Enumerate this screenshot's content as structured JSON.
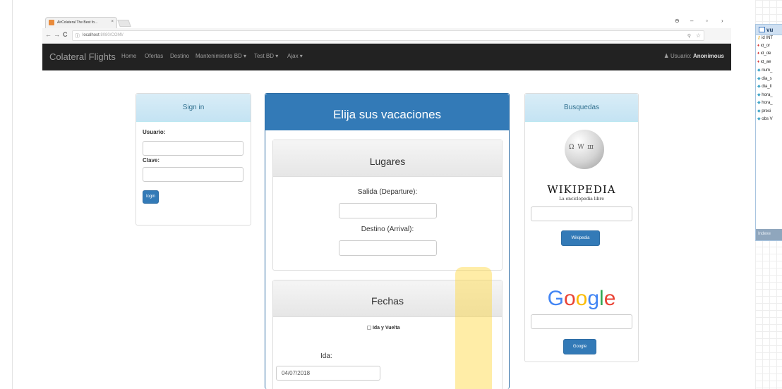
{
  "browser": {
    "tab_title": "AirColateral The Best fo...",
    "tab_close": "×",
    "window_controls": {
      "profile": "⊖",
      "minimize": "–",
      "maximize": "▫",
      "close": "›"
    },
    "url_host": "localhost",
    "url_path": ":8080/COMI/",
    "nav_back": "←",
    "nav_forward": "→",
    "nav_reload": "C",
    "secure_icon": "ⓘ",
    "zoom_icon": "⚲",
    "star_icon": "☆"
  },
  "navbar": {
    "brand": "Colateral Flights",
    "items": [
      "Home",
      "Ofertas",
      "Destino",
      "Mantenimiento BD ▾",
      "Test BD ▾",
      "Ajax ▾"
    ],
    "user_label": "Usuario:",
    "user_name": "Anonimous",
    "user_icon": "person-icon"
  },
  "signin": {
    "title": "Sign in",
    "user_label": "Usuario:",
    "pass_label": "Clave:",
    "login_button": "login"
  },
  "main": {
    "title": "Elija sus vacaciones",
    "lugares": {
      "title": "Lugares",
      "departure_label": "Salida (Departure):",
      "arrival_label": "Destino (Arrival):"
    },
    "fechas": {
      "title": "Fechas",
      "roundtrip_label": "Ida y Vuelta",
      "ida_label": "Ida:",
      "ida_value": "04/07/2018"
    }
  },
  "busquedas": {
    "title": "Busquedas",
    "wiki_word": "WIKIPEDIA",
    "wiki_subtitle": "La enciclopedia libre",
    "wiki_button": "Wikipedia",
    "google_button": "Google"
  },
  "db_table": {
    "title": "vu",
    "rows": [
      {
        "icon": "key",
        "label": "id INT"
      },
      {
        "icon": "fk",
        "label": "id_or"
      },
      {
        "icon": "fk",
        "label": "id_de"
      },
      {
        "icon": "fk",
        "label": "id_ae"
      },
      {
        "icon": "col",
        "label": "num_"
      },
      {
        "icon": "col",
        "label": "dia_s"
      },
      {
        "icon": "col",
        "label": "dia_ll"
      },
      {
        "icon": "col",
        "label": "hora_"
      },
      {
        "icon": "col",
        "label": "hora_"
      },
      {
        "icon": "col",
        "label": "preci"
      },
      {
        "icon": "col",
        "label": "obs V"
      }
    ],
    "footer": "Indexe"
  },
  "colors": {
    "navbar": "#222222",
    "primary": "#337ab7",
    "info_head": "#d9edf7",
    "highlight": "#ffd63c"
  }
}
